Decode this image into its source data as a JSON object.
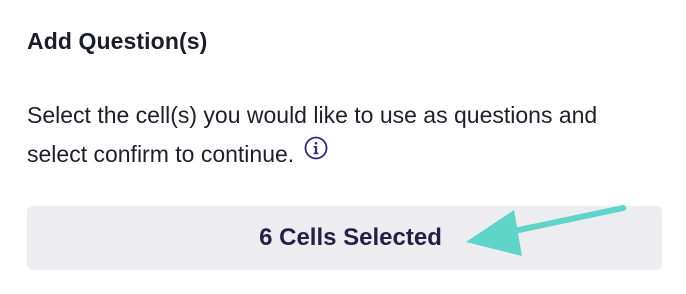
{
  "panel": {
    "title": "Add Question(s)",
    "description": "Select the cell(s) you would like to use as questions and select confirm to continue.",
    "info_icon": "info-circle-icon",
    "selection_label": "6 Cells Selected"
  },
  "annotation": {
    "arrow_icon": "arrow-left-icon",
    "arrow_color": "#5fd4c8"
  },
  "colors": {
    "bar_bg": "#ececf1",
    "label_color": "#231f45",
    "icon_color": "#2f2a7a"
  }
}
